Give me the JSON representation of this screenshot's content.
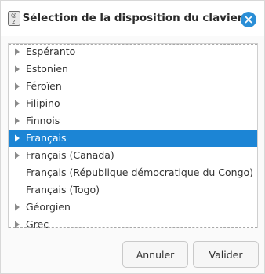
{
  "dialog": {
    "title": "Sélection de la disposition du clavier",
    "app_icon": "keyboard-icon",
    "close_icon": "close-icon",
    "accent_color": "#1c85d5"
  },
  "list": {
    "items": [
      {
        "label": "Espéranto",
        "expandable": true,
        "selected": false
      },
      {
        "label": "Estonien",
        "expandable": true,
        "selected": false
      },
      {
        "label": "Féroïen",
        "expandable": true,
        "selected": false
      },
      {
        "label": "Filipino",
        "expandable": true,
        "selected": false
      },
      {
        "label": "Finnois",
        "expandable": true,
        "selected": false
      },
      {
        "label": "Français",
        "expandable": true,
        "selected": true
      },
      {
        "label": "Français (Canada)",
        "expandable": true,
        "selected": false
      },
      {
        "label": "Français (République démocratique du Congo)",
        "expandable": false,
        "selected": false
      },
      {
        "label": "Français (Togo)",
        "expandable": false,
        "selected": false
      },
      {
        "label": "Géorgien",
        "expandable": true,
        "selected": false
      },
      {
        "label": "Grec",
        "expandable": true,
        "selected": false
      }
    ]
  },
  "buttons": {
    "cancel_label": "Annuler",
    "ok_label": "Valider"
  }
}
